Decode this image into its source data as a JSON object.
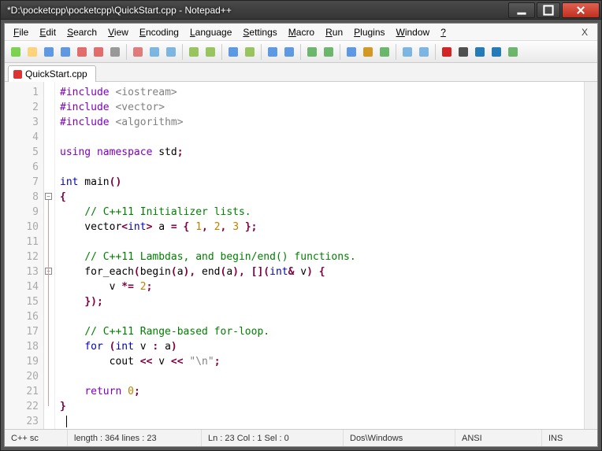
{
  "window": {
    "title": "*D:\\pocketcpp\\pocketcpp\\QuickStart.cpp - Notepad++"
  },
  "menu": {
    "items": [
      "File",
      "Edit",
      "Search",
      "View",
      "Encoding",
      "Language",
      "Settings",
      "Macro",
      "Run",
      "Plugins",
      "Window",
      "?"
    ],
    "right": "X"
  },
  "tabs": [
    {
      "label": "QuickStart.cpp",
      "modified": true
    }
  ],
  "status": {
    "lang": "C++ sc",
    "length": "length : 364    lines : 23",
    "pos": "Ln : 23    Col : 1    Sel : 0",
    "eol": "Dos\\Windows",
    "enc": "ANSI",
    "mode": "INS"
  },
  "lineCount": 23,
  "code_lines": [
    [
      [
        "kw1",
        "#include "
      ],
      [
        "str",
        "<iostream>"
      ]
    ],
    [
      [
        "kw1",
        "#include "
      ],
      [
        "str",
        "<vector>"
      ]
    ],
    [
      [
        "kw1",
        "#include "
      ],
      [
        "str",
        "<algorithm>"
      ]
    ],
    [],
    [
      [
        "kw1",
        "using namespace"
      ],
      [
        "id",
        " std"
      ],
      [
        "op",
        ";"
      ]
    ],
    [],
    [
      [
        "kw2",
        "int"
      ],
      [
        "id",
        " main"
      ],
      [
        "op",
        "()"
      ]
    ],
    [
      [
        "op",
        "{"
      ]
    ],
    [
      [
        "id",
        "    "
      ],
      [
        "cmt",
        "// C++11 Initializer lists."
      ]
    ],
    [
      [
        "id",
        "    vector"
      ],
      [
        "op",
        "<"
      ],
      [
        "kw2",
        "int"
      ],
      [
        "op",
        ">"
      ],
      [
        "id",
        " a "
      ],
      [
        "op",
        "= { "
      ],
      [
        "num",
        "1"
      ],
      [
        "op",
        ", "
      ],
      [
        "num",
        "2"
      ],
      [
        "op",
        ", "
      ],
      [
        "num",
        "3"
      ],
      [
        "op",
        " };"
      ]
    ],
    [],
    [
      [
        "id",
        "    "
      ],
      [
        "cmt",
        "// C++11 Lambdas, and begin/end() functions."
      ]
    ],
    [
      [
        "id",
        "    for_each"
      ],
      [
        "op",
        "("
      ],
      [
        "id",
        "begin"
      ],
      [
        "op",
        "("
      ],
      [
        "id",
        "a"
      ],
      [
        "op",
        "), "
      ],
      [
        "id",
        "end"
      ],
      [
        "op",
        "("
      ],
      [
        "id",
        "a"
      ],
      [
        "op",
        "), []("
      ],
      [
        "kw2",
        "int"
      ],
      [
        "op",
        "& "
      ],
      [
        "id",
        "v"
      ],
      [
        "op",
        ") {"
      ]
    ],
    [
      [
        "id",
        "        v "
      ],
      [
        "op",
        "*= "
      ],
      [
        "num",
        "2"
      ],
      [
        "op",
        ";"
      ]
    ],
    [
      [
        "id",
        "    "
      ],
      [
        "op",
        "});"
      ]
    ],
    [],
    [
      [
        "id",
        "    "
      ],
      [
        "cmt",
        "// C++11 Range-based for-loop."
      ]
    ],
    [
      [
        "id",
        "    "
      ],
      [
        "kw2",
        "for"
      ],
      [
        "op",
        " ("
      ],
      [
        "kw2",
        "int"
      ],
      [
        "id",
        " v "
      ],
      [
        "op",
        ": "
      ],
      [
        "id",
        "a"
      ],
      [
        "op",
        ")"
      ]
    ],
    [
      [
        "id",
        "        cout "
      ],
      [
        "op",
        "<< "
      ],
      [
        "id",
        "v "
      ],
      [
        "op",
        "<< "
      ],
      [
        "str",
        "\"\\n\""
      ],
      [
        "op",
        ";"
      ]
    ],
    [],
    [
      [
        "id",
        "    "
      ],
      [
        "kw1",
        "return"
      ],
      [
        "id",
        " "
      ],
      [
        "num",
        "0"
      ],
      [
        "op",
        ";"
      ]
    ],
    [
      [
        "op",
        "}"
      ]
    ],
    []
  ],
  "toolbar_icons": [
    "new",
    "open",
    "save",
    "save-all",
    "close",
    "close-all",
    "print",
    "sep",
    "cut",
    "copy",
    "paste",
    "sep",
    "undo",
    "redo",
    "sep",
    "find",
    "replace",
    "sep",
    "zoom-in",
    "zoom-out",
    "sep",
    "sync-v",
    "sync-h",
    "sep",
    "wrap",
    "all-chars",
    "indent",
    "sep",
    "fold-region",
    "unfold",
    "sep",
    "rec",
    "stop",
    "play",
    "play-multi",
    "save-macro"
  ],
  "icon_colors": {
    "new": "#6c3",
    "open": "#fc6",
    "save": "#48d",
    "save-all": "#48d",
    "close": "#d55",
    "close-all": "#d55",
    "print": "#888",
    "cut": "#d66",
    "copy": "#6ad",
    "paste": "#6ad",
    "undo": "#8b4",
    "redo": "#8b4",
    "find": "#48d",
    "replace": "#8b4",
    "zoom-in": "#48d",
    "zoom-out": "#48d",
    "sync-v": "#5a5",
    "sync-h": "#5a5",
    "wrap": "#48d",
    "all-chars": "#c80",
    "indent": "#5a5",
    "fold-region": "#6ad",
    "unfold": "#6ad",
    "rec": "#c00",
    "stop": "#333",
    "play": "#06a",
    "play-multi": "#06a",
    "save-macro": "#5a5"
  }
}
